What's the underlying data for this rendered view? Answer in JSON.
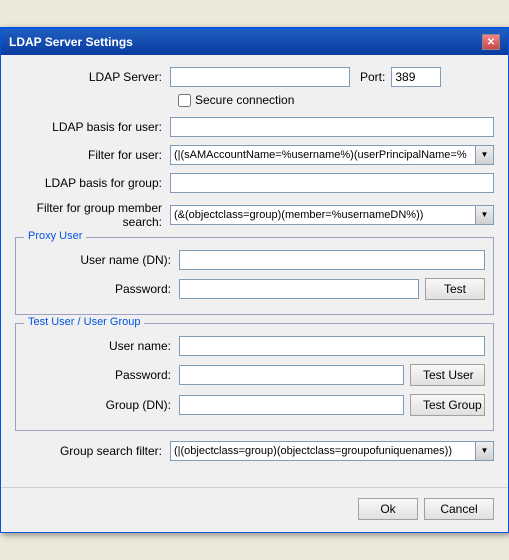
{
  "window": {
    "title": "LDAP Server Settings",
    "close_btn": "✕"
  },
  "fields": {
    "ldap_server_label": "LDAP Server:",
    "ldap_server_value": "",
    "port_label": "Port:",
    "port_value": "389",
    "secure_label": "Secure connection",
    "ldap_basis_user_label": "LDAP basis for user:",
    "ldap_basis_user_value": "",
    "filter_user_label": "Filter for user:",
    "filter_user_value": "(|(sAMAccountName=%username%)(userPrincipalName=%",
    "ldap_basis_group_label": "LDAP basis for group:",
    "ldap_basis_group_value": "",
    "filter_group_label": "Filter for group member search:",
    "filter_group_value": "(&(objectclass=group)(member=%usernameDN%))",
    "group_search_filter_label": "Group search filter:",
    "group_search_filter_value": "(|(objectclass=group)(objectclass=groupofuniquenames))"
  },
  "proxy_user": {
    "title": "Proxy User",
    "username_label": "User name (DN):",
    "username_value": "",
    "password_label": "Password:",
    "password_value": "",
    "test_btn": "Test"
  },
  "test_section": {
    "title": "Test User / User Group",
    "username_label": "User name:",
    "username_value": "",
    "password_label": "Password:",
    "password_value": "",
    "group_label": "Group (DN):",
    "group_value": "",
    "test_user_btn": "Test User",
    "test_group_btn": "Test Group"
  },
  "footer": {
    "ok_label": "Ok",
    "cancel_label": "Cancel"
  }
}
